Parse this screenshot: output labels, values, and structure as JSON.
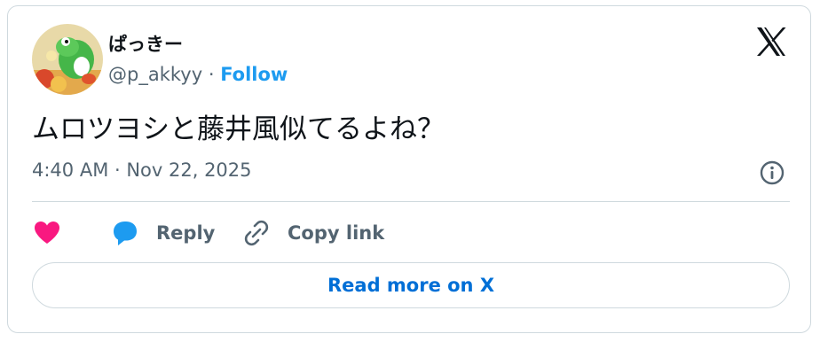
{
  "author": {
    "display_name": "ぱっきー",
    "handle": "@p_akkyy",
    "separator": "·",
    "follow_label": "Follow"
  },
  "tweet": {
    "text": "ムロツヨシと藤井風似てるよね？",
    "timestamp": "4:40 AM · Nov 22, 2025"
  },
  "actions": {
    "like_icon": "heart-icon",
    "reply_label": "Reply",
    "reply_icon": "speech-bubble-icon",
    "copy_label": "Copy link",
    "copy_icon": "link-icon"
  },
  "footer": {
    "read_more_label": "Read more on X"
  },
  "colors": {
    "accent": "#1d9bf0",
    "link": "#006fd6",
    "like": "#f91880",
    "secondary_text": "#536471",
    "border": "#cfd9de"
  }
}
